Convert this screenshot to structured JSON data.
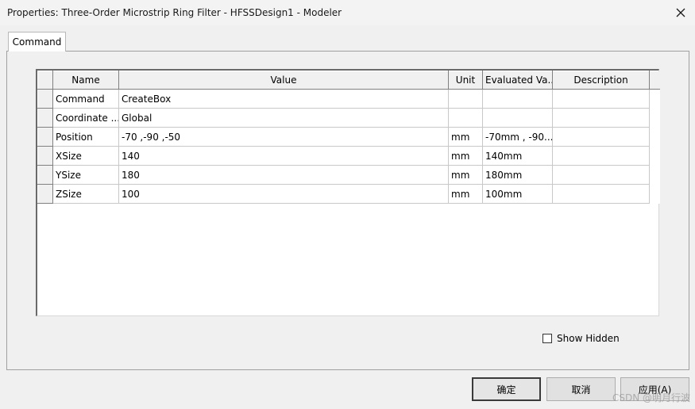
{
  "window": {
    "title": "Properties: Three-Order Microstrip Ring Filter - HFSSDesign1 - Modeler",
    "close_icon": "close-icon"
  },
  "tab": {
    "label": "Command"
  },
  "grid": {
    "columns": [
      "Name",
      "Value",
      "Unit",
      "Evaluated Va...",
      "Description"
    ],
    "rows": [
      {
        "name": "Command",
        "value": "CreateBox",
        "unit": "",
        "evaluated": "",
        "description": ""
      },
      {
        "name": "Coordinate ...",
        "value": "Global",
        "unit": "",
        "evaluated": "",
        "description": ""
      },
      {
        "name": "Position",
        "value": "-70 ,-90 ,-50",
        "unit": "mm",
        "evaluated": "-70mm , -90...",
        "description": ""
      },
      {
        "name": "XSize",
        "value": "140",
        "unit": "mm",
        "evaluated": "140mm",
        "description": ""
      },
      {
        "name": "YSize",
        "value": "180",
        "unit": "mm",
        "evaluated": "180mm",
        "description": ""
      },
      {
        "name": "ZSize",
        "value": "100",
        "unit": "mm",
        "evaluated": "100mm",
        "description": ""
      }
    ]
  },
  "show_hidden": {
    "label": "Show Hidden",
    "checked": false
  },
  "buttons": {
    "ok": "确定",
    "cancel": "取消",
    "apply": "应用(A)"
  },
  "watermark": "CSDN @明月行波"
}
